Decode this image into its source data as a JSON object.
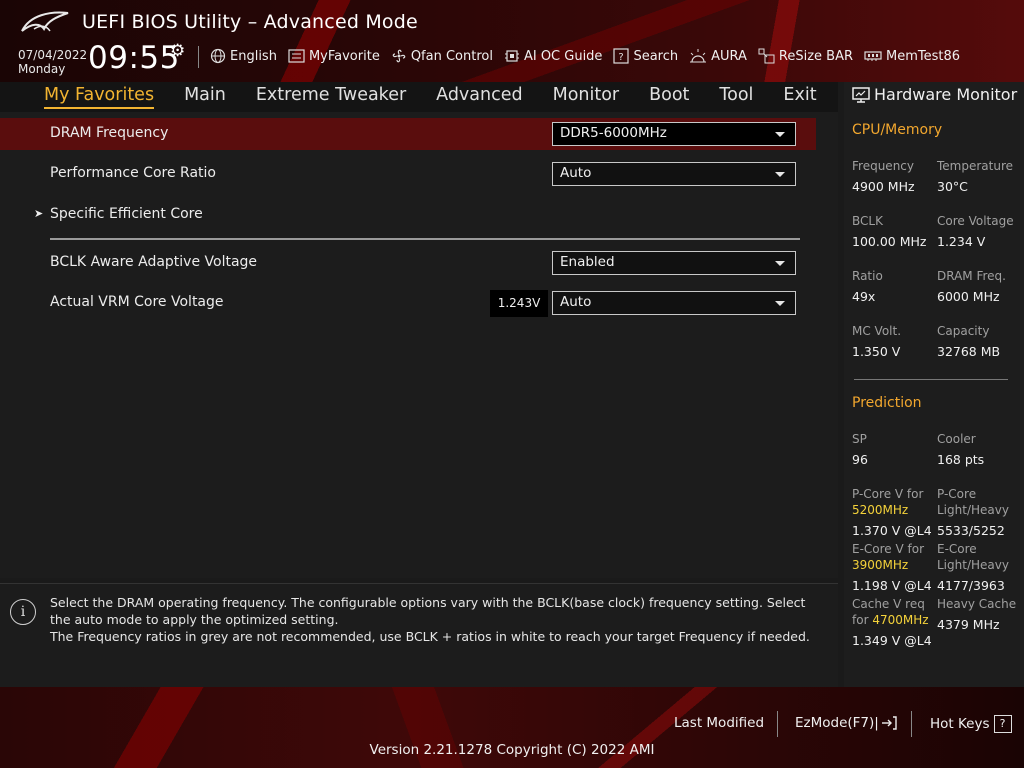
{
  "header": {
    "title": "UEFI BIOS Utility – Advanced Mode",
    "date": "07/04/2022",
    "day": "Monday",
    "time": "09:55"
  },
  "toolbar": {
    "items": [
      {
        "label": "English",
        "icon": "globe-icon"
      },
      {
        "label": "MyFavorite",
        "icon": "favorite-list-icon"
      },
      {
        "label": "Qfan Control",
        "icon": "fan-icon"
      },
      {
        "label": "AI OC Guide",
        "icon": "chip-icon"
      },
      {
        "label": "Search",
        "icon": "question-box-icon"
      },
      {
        "label": "AURA",
        "icon": "aura-light-icon"
      },
      {
        "label": "ReSize BAR",
        "icon": "resize-bar-icon"
      },
      {
        "label": "MemTest86",
        "icon": "memory-icon"
      }
    ]
  },
  "nav": {
    "tabs": [
      "My Favorites",
      "Main",
      "Extreme Tweaker",
      "Advanced",
      "Monitor",
      "Boot",
      "Tool",
      "Exit"
    ],
    "active": "My Favorites"
  },
  "settings": {
    "dram_frequency": {
      "label": "DRAM Frequency",
      "value": "DDR5-6000MHz"
    },
    "perf_core_ratio": {
      "label": "Performance Core Ratio",
      "value": "Auto"
    },
    "specific_efficient_core": {
      "label": "Specific Efficient Core"
    },
    "bclk_aware": {
      "label": "BCLK Aware Adaptive Voltage",
      "value": "Enabled"
    },
    "vrm_core_voltage": {
      "label": "Actual VRM Core Voltage",
      "reading": "1.243V",
      "value": "Auto"
    }
  },
  "help": {
    "line1": "Select the DRAM operating frequency. The configurable options vary with the BCLK(base clock) frequency setting. Select the auto mode to apply the optimized setting.",
    "line2": "The Frequency ratios in grey are not recommended, use BCLK + ratios in white to reach your target Frequency if needed."
  },
  "hardware_monitor": {
    "title": "Hardware Monitor",
    "cpu_memory": {
      "title": "CPU/Memory",
      "frequency": {
        "label": "Frequency",
        "value": "4900 MHz"
      },
      "temperature": {
        "label": "Temperature",
        "value": "30°C"
      },
      "bclk": {
        "label": "BCLK",
        "value": "100.00 MHz"
      },
      "core_voltage": {
        "label": "Core Voltage",
        "value": "1.234 V"
      },
      "ratio": {
        "label": "Ratio",
        "value": "49x"
      },
      "dram_freq": {
        "label": "DRAM Freq.",
        "value": "6000 MHz"
      },
      "mc_volt": {
        "label": "MC Volt.",
        "value": "1.350 V"
      },
      "capacity": {
        "label": "Capacity",
        "value": "32768 MB"
      }
    },
    "prediction": {
      "title": "Prediction",
      "sp": {
        "label": "SP",
        "value": "96"
      },
      "cooler": {
        "label": "Cooler",
        "value": "168 pts"
      },
      "pcore_v": {
        "label": "P-Core V for",
        "freq": "5200MHz",
        "value": "1.370 V @L4"
      },
      "pcore_lh": {
        "label1": "P-Core",
        "label2": "Light/Heavy",
        "value": "5533/5252"
      },
      "ecore_v": {
        "label": "E-Core V for",
        "freq": "3900MHz",
        "value": "1.198 V @L4"
      },
      "ecore_lh": {
        "label1": "E-Core",
        "label2": "Light/Heavy",
        "value": "4177/3963"
      },
      "cache_v": {
        "label1": "Cache V req",
        "label2": "for",
        "freq": "4700MHz",
        "value": "1.349 V @L4"
      },
      "heavy_cache": {
        "label": "Heavy Cache",
        "value": "4379 MHz"
      }
    }
  },
  "footer": {
    "last_modified": "Last Modified",
    "ezmode": "EzMode(F7)|",
    "hot_keys": "Hot Keys",
    "hot_keys_glyph": "?",
    "version": "Version 2.21.1278 Copyright (C) 2022 AMI"
  },
  "colors": {
    "accent": "#f2b431",
    "highlight_row": "#5a0d0d",
    "prediction_freq": "#f4d23a"
  }
}
